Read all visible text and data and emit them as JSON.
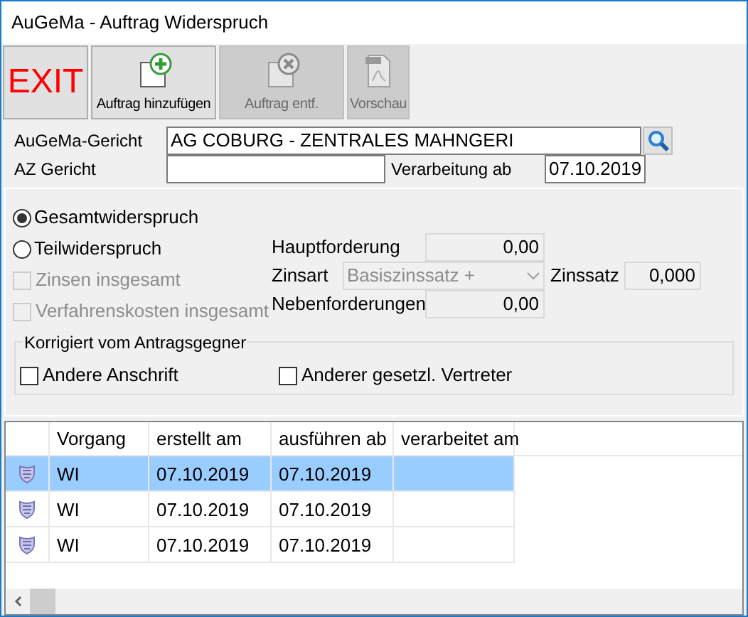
{
  "window": {
    "title": "AuGeMa - Auftrag Widerspruch"
  },
  "toolbar": [
    {
      "label": "EXIT",
      "kind": "exit",
      "disabled": false
    },
    {
      "label": "Auftrag hinzufügen",
      "kind": "add",
      "disabled": false
    },
    {
      "label": "Auftrag entf.",
      "kind": "remove",
      "disabled": true
    },
    {
      "label": "Vorschau",
      "kind": "pdf",
      "disabled": true
    }
  ],
  "form": {
    "gericht_label": "AuGeMa-Gericht",
    "gericht_value": "AG COBURG - ZENTRALES MAHNGERI",
    "az_label": "AZ Gericht",
    "verarbeitung_label": "Verarbeitung ab",
    "verarbeitung_value": "07.10.2019"
  },
  "widerspruch": {
    "radios": [
      {
        "label": "Gesamtwiderspruch",
        "selected": true
      },
      {
        "label": "Teilwiderspruch",
        "selected": false
      }
    ],
    "checkboxes": [
      {
        "label": "Zinsen insgesamt",
        "checked": false,
        "disabled": true
      },
      {
        "label": "Verfahrenskosten insgesamt",
        "checked": false,
        "disabled": true
      }
    ],
    "hauptforderung": {
      "label": "Hauptforderung",
      "value": "0,00"
    },
    "zinsart": {
      "label": "Zinsart",
      "value": "Basiszinssatz +"
    },
    "zinssatz": {
      "label": "Zinssatz",
      "value": "0,000"
    },
    "nebenforderungen": {
      "label": "Nebenforderungen",
      "value": "0,00"
    }
  },
  "korrigiert": {
    "title": "Korrigiert vom Antragsgegner",
    "checkboxes": [
      {
        "label": "Andere Anschrift",
        "checked": false
      },
      {
        "label": "Anderer gesetzl. Vertreter",
        "checked": false
      }
    ]
  },
  "table": {
    "columns": [
      "Vorgang",
      "erstellt am",
      "ausführen ab",
      "verarbeitet am"
    ],
    "rows": [
      {
        "selected": true,
        "cells": [
          "WI",
          "07.10.2019",
          "07.10.2019"
        ]
      },
      {
        "selected": false,
        "cells": [
          "WI",
          "07.10.2019",
          "07.10.2019"
        ]
      },
      {
        "selected": false,
        "cells": [
          "WI",
          "07.10.2019",
          "07.10.2019"
        ]
      }
    ]
  }
}
